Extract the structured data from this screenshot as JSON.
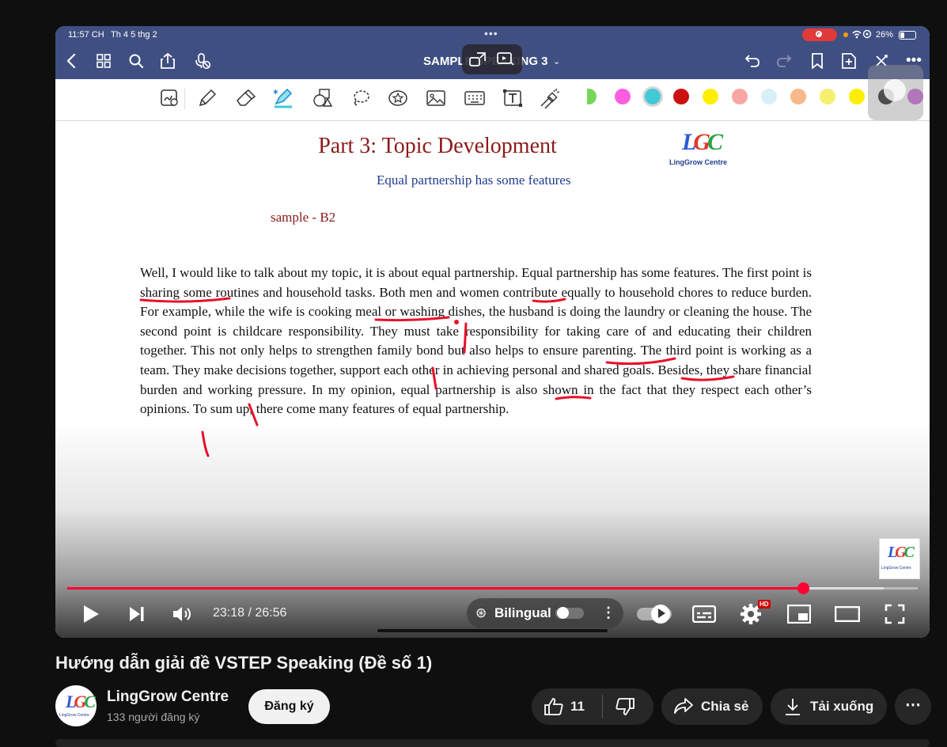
{
  "status": {
    "time": "11:57 CH",
    "date": "Th 4 5 thg 2",
    "battery": "26%"
  },
  "nav": {
    "doc_title": "SAMPLE SPEAKING 3"
  },
  "swatches": [
    "#77d65a",
    "#ff5ee0",
    "#41c9d7",
    "#cc1010",
    "#ffee00",
    "#f7a6a3",
    "#d7f0f7",
    "#f8b98a",
    "#f5f06e",
    "#ffee00",
    "#111111",
    "#c55bd6"
  ],
  "document": {
    "heading": "Part 3: Topic Development",
    "subheading": "Equal partnership has some features",
    "sample": "sample - B2",
    "logo_name": "LingGrow Centre",
    "body": "Well, I would like to talk about my topic, it is about equal partnership. Equal partnership has some features. The first point is sharing some routines and household tasks. Both men and women contribute equally to household chores to reduce burden. For example, while the wife is cooking meal or washing dishes, the husband is doing the laundry or cleaning the house. The second point is childcare responsibility. They must take responsibility for taking care of and educating their children together. This not only helps to strengthen family bond but also helps to ensure parenting. The third point is working as a team. They make decisions together, support each other in achieving personal and shared goals. Besides, they share financial burden and working pressure. In my opinion, equal partnership is also shown in the fact that they respect each other’s opinions. To sum up, there come many features of equal partnership.",
    "watermark_name": "LingGrow Centre"
  },
  "player": {
    "time_display": "23:18 / 26:56",
    "progress_fraction": 0.865,
    "buffered_fraction": 0.96,
    "bilingual_label": "Bilingual",
    "hd_badge": "HD"
  },
  "video": {
    "title": "Hướng dẫn giải đề VSTEP Speaking (Đề số 1)",
    "channel_name": "LingGrow Centre",
    "subscribers": "133 người đăng ký",
    "subscribe_label": "Đăng ký",
    "like_count": "11",
    "share_label": "Chia sẻ",
    "download_label": "Tải xuống",
    "avatar_name": "LingGrow Centre"
  }
}
